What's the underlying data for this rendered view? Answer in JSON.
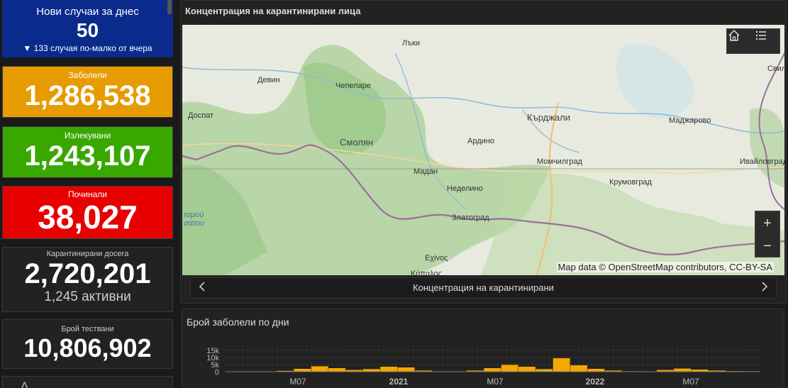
{
  "stats": {
    "new_today": {
      "label": "Нови случаи за днес",
      "value": "50",
      "delta": "▼ 133 случая по-малко от вчера",
      "color": "#0a2a8c"
    },
    "infected": {
      "label": "Заболели",
      "value": "1,286,538",
      "color": "#e69b00"
    },
    "recovered": {
      "label": "Излекувани",
      "value": "1,243,107",
      "color": "#38a800"
    },
    "deceased": {
      "label": "Починали",
      "value": "38,027",
      "color": "#e60000"
    },
    "quarantined": {
      "label": "Карантинирани досега",
      "value": "2,720,201",
      "sub": "1,245 активни",
      "color": "#222222"
    },
    "tested": {
      "label": "Брой тествани",
      "value": "10,806,902",
      "color": "#222222"
    },
    "next_card_glyph": "Δ"
  },
  "map_panel": {
    "title": "Концентрация на карантинирани лица",
    "places": {
      "laki": "Лъки",
      "devin": "Девин",
      "chepelare": "Чепеларе",
      "dospat": "Доспат",
      "smolyan": "Смолян",
      "ardino": "Ардино",
      "kardzhali": "Кърджали",
      "madzharovo": "Маджарово",
      "momchilgrad": "Момчилград",
      "madan": "Мадан",
      "nedelino": "Неделино",
      "krumovgrad": "Крумовград",
      "ivaylovgrad": "Ивайловград",
      "zlatograd": "Златоград",
      "echinos": "Εχίνος",
      "thaisou": "ταμού",
      "tsotou": "σατου",
      "svil": "Свил",
      "kuzos": "Κύπαλος"
    },
    "attribution": "Map data © OpenStreetMap contributors, CC-BY-SA",
    "zoom_in": "+",
    "zoom_out": "−",
    "carousel_caption": "Концентрация на карантинирани"
  },
  "chart_panel": {
    "title": "Брой заболели по дни"
  },
  "chart_data": {
    "type": "bar",
    "title": "Брой заболели по дни",
    "y_ticks": [
      "15k",
      "10k",
      "5k",
      "0"
    ],
    "ylim": [
      0,
      15000
    ],
    "x_ticks": [
      "M07",
      "2021",
      "M07",
      "2022",
      "M07"
    ],
    "series": [
      {
        "color": "#f5a800",
        "x": [
          "2020-03",
          "2020-05",
          "2020-07",
          "2020-09",
          "2020-10",
          "2020-11",
          "2020-12",
          "2021-01",
          "2021-02",
          "2021-03",
          "2021-04",
          "2021-05",
          "2021-06",
          "2021-07",
          "2021-08",
          "2021-09",
          "2021-10",
          "2021-11",
          "2021-12",
          "2022-01",
          "2022-02",
          "2022-03",
          "2022-04",
          "2022-05",
          "2022-06",
          "2022-07",
          "2022-08",
          "2022-09",
          "2022-10",
          "2022-11",
          "2022-12"
        ],
        "values": [
          50,
          100,
          200,
          600,
          2000,
          3800,
          2500,
          1200,
          1800,
          3500,
          3000,
          800,
          150,
          100,
          800,
          2500,
          4800,
          3500,
          1800,
          9500,
          4500,
          2000,
          800,
          300,
          200,
          1200,
          2200,
          1500,
          800,
          400,
          300
        ]
      }
    ]
  }
}
